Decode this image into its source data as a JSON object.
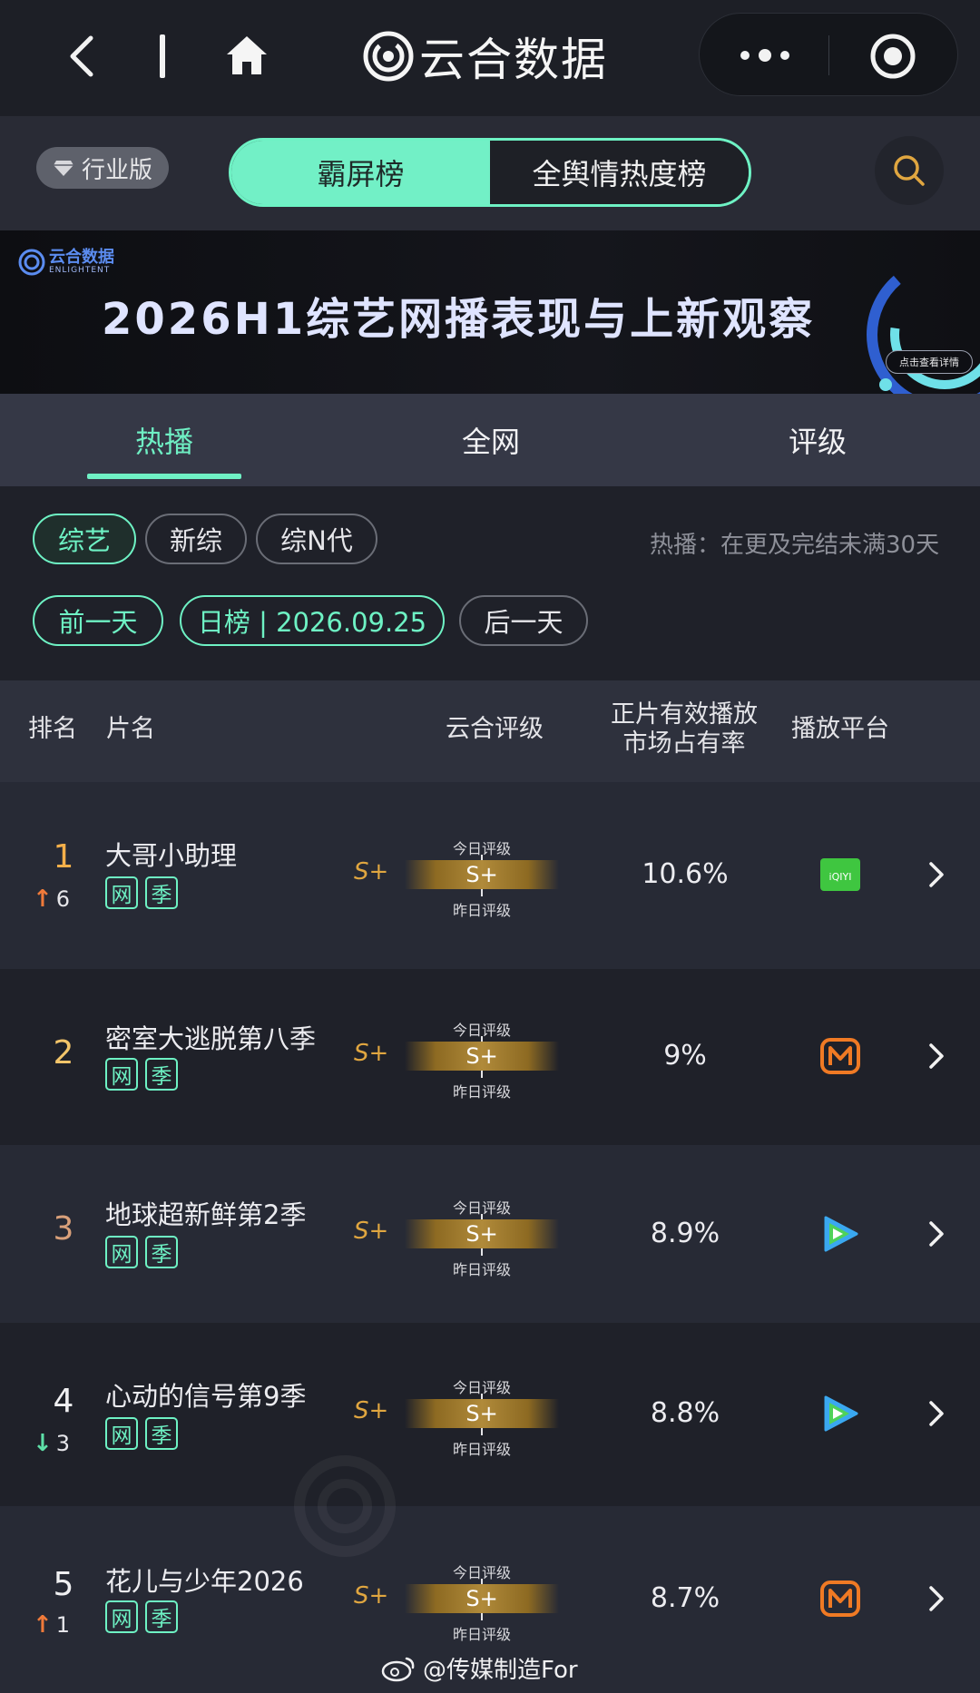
{
  "nav": {
    "brand_name": "云合数据"
  },
  "toggle": {
    "pro_label": "行业版",
    "tabs": [
      "霸屏榜",
      "全舆情热度榜"
    ]
  },
  "banner": {
    "brand_cn": "云合数据",
    "brand_en": "ENLIGHTENT",
    "title": "2026H1综艺网播表现与上新观察",
    "cta": "点击查看详情"
  },
  "subtabs": [
    "热播",
    "全网",
    "评级"
  ],
  "filters": {
    "categories": [
      "综艺",
      "新综",
      "综N代"
    ],
    "note": "热播：在更及完结未满30天",
    "prev_day": "前一天",
    "current": "日榜 | 2026.09.25",
    "next_day": "后一天"
  },
  "table": {
    "headers": {
      "rank": "排名",
      "title": "片名",
      "rating": "云合评级",
      "share_line1": "正片有效播放",
      "share_line2": "市场占有率",
      "platform": "播放平台"
    },
    "rating_today_label": "今日评级",
    "rating_yesterday_label": "昨日评级",
    "tag_net": "网",
    "tag_season": "季",
    "rows": [
      {
        "rank": "1",
        "trend_dir": "up",
        "trend_value": "6",
        "title": "大哥小助理",
        "grade_left": "S+",
        "grade_bar": "S+",
        "share": "10.6%",
        "platform": "iqiyi-icon"
      },
      {
        "rank": "2",
        "trend_dir": "",
        "trend_value": "",
        "title": "密室大逃脱第八季",
        "grade_left": "S+",
        "grade_bar": "S+",
        "share": "9%",
        "platform": "mgtv-icon"
      },
      {
        "rank": "3",
        "trend_dir": "",
        "trend_value": "",
        "title": "地球超新鲜第2季",
        "grade_left": "S+",
        "grade_bar": "S+",
        "share": "8.9%",
        "platform": "tencent-video-icon"
      },
      {
        "rank": "4",
        "trend_dir": "down",
        "trend_value": "3",
        "title": "心动的信号第9季",
        "grade_left": "S+",
        "grade_bar": "S+",
        "share": "8.8%",
        "platform": "tencent-video-icon"
      },
      {
        "rank": "5",
        "trend_dir": "up",
        "trend_value": "1",
        "title": "花儿与少年2026",
        "grade_left": "S+",
        "grade_bar": "S+",
        "share": "8.7%",
        "platform": "mgtv-icon"
      }
    ]
  },
  "platform_labels": {
    "iqiyi": "iQIYI"
  },
  "footer": {
    "weibo_handle": "@传媒制造For"
  },
  "colors": {
    "accent": "#6ef2c4",
    "rank_gold": "#f5b04a",
    "trend_up": "#f07a3a",
    "trend_down": "#5ee0a8"
  }
}
